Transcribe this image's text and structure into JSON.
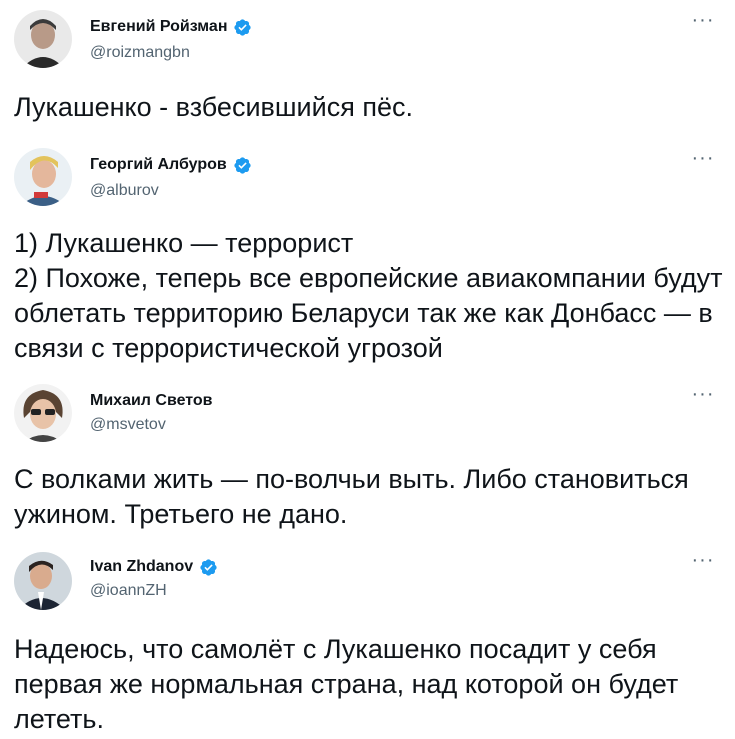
{
  "colors": {
    "text": "#0f1419",
    "secondary": "#536471",
    "verified_blue": "#1d9bf0"
  },
  "tweets": [
    {
      "name": "Евгений Ройзман",
      "handle": "@roizmangbn",
      "verified": true,
      "text": "Лукашенко - взбесившийся пёс."
    },
    {
      "name": "Георгий Албуров",
      "handle": "@alburov",
      "verified": true,
      "text": "1) Лукашенко — террорист\n2) Похоже, теперь все европейские авиакомпании будут облетать территорию Беларуси так же как Донбасс — в связи с террористической угрозой"
    },
    {
      "name": "Михаил Светов",
      "handle": "@msvetov",
      "verified": false,
      "text": "С волками жить — по-волчьи выть. Либо становиться ужином. Третьего не дано."
    },
    {
      "name": "Ivan Zhdanov",
      "handle": "@ioannZH",
      "verified": true,
      "text": "Надеюсь, что самолёт с Лукашенко посадит у себя первая же нормальная страна, над которой он будет лететь."
    }
  ],
  "icons": {
    "more": "more-horizontal-icon",
    "verified": "verified-badge-icon"
  }
}
